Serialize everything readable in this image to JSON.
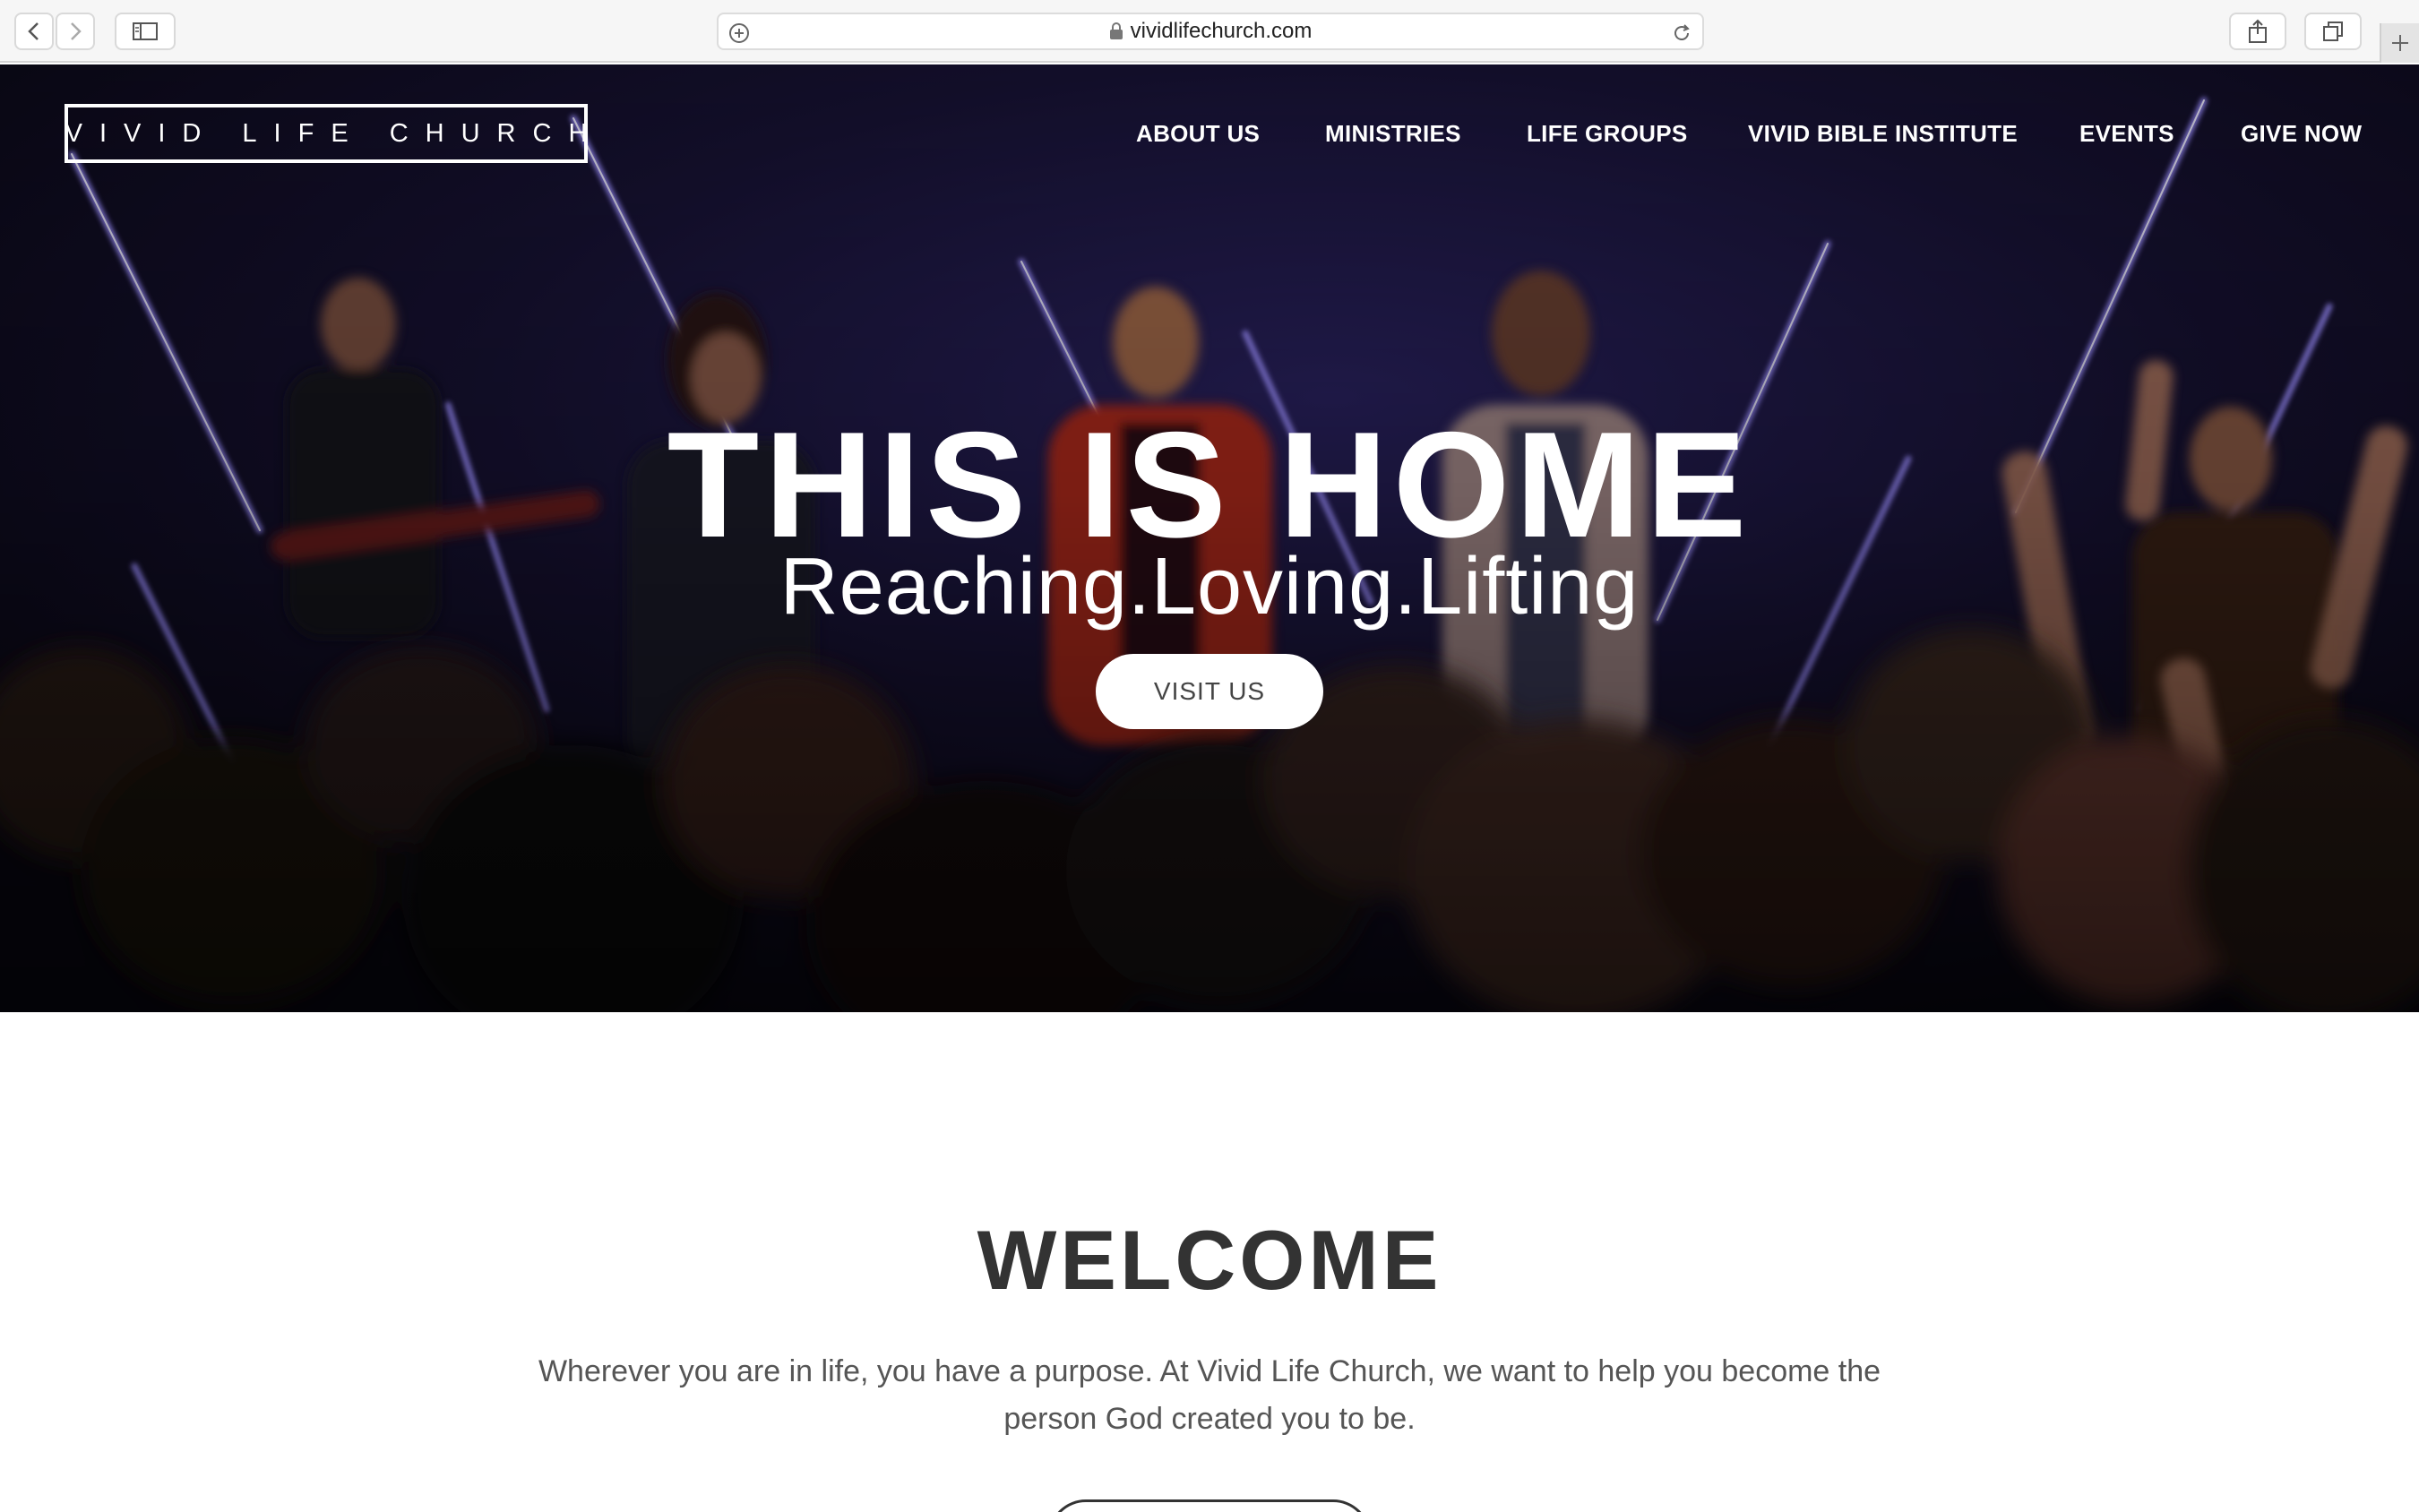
{
  "browser": {
    "url": "vividlifechurch.com",
    "icons": [
      "back-icon",
      "forward-icon",
      "sidebar-icon",
      "add-icon",
      "lock-icon",
      "reload-icon",
      "share-icon",
      "tabs-icon",
      "new-tab-icon"
    ]
  },
  "header": {
    "logo": "VIVID LIFE CHURCH",
    "nav": [
      {
        "label": "ABOUT US"
      },
      {
        "label": "MINISTRIES"
      },
      {
        "label": "LIFE GROUPS"
      },
      {
        "label": "VIVID BIBLE INSTITUTE"
      },
      {
        "label": "EVENTS"
      },
      {
        "label": "GIVE NOW"
      }
    ]
  },
  "hero": {
    "title": "THIS IS HOME",
    "subtitle": "Reaching.Loving.Lifting",
    "cta": "VISIT US"
  },
  "welcome": {
    "title": "WELCOME",
    "text": "Wherever you are in life, you have a purpose. At Vivid Life Church, we want to help you become the person God created you to be."
  },
  "colors": {
    "hero_dark": "#0e0a1c",
    "light_stripes": "#8a7cff",
    "text_dark": "#333333"
  }
}
